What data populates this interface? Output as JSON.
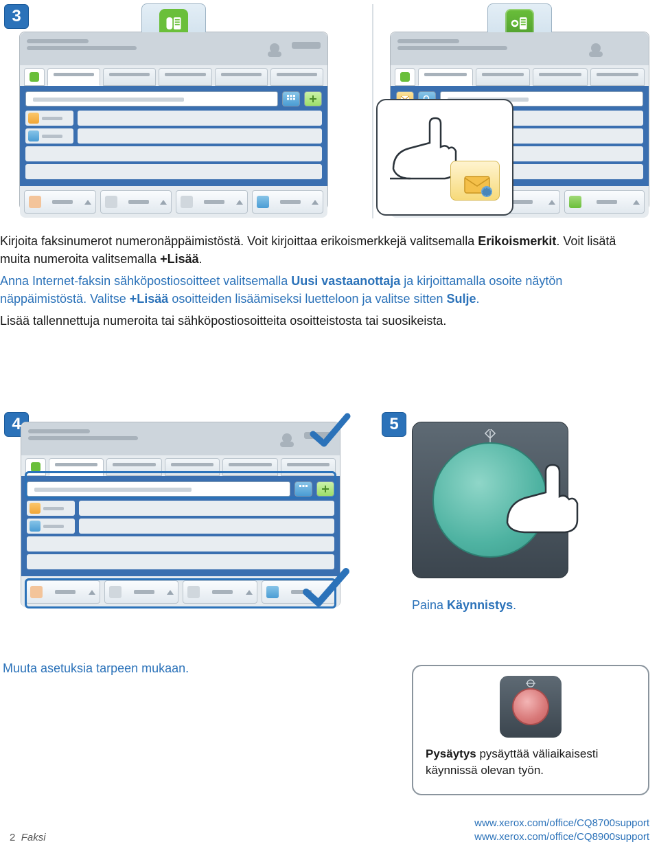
{
  "steps": {
    "s3": "3",
    "s4": "4",
    "s5": "5"
  },
  "instruction_block": {
    "line1a": "Kirjoita faksinumerot numeronäppäimistöstä. Voit kirjoittaa erikoismerkkejä valitsemalla ",
    "line1b_bold": "Erikoismerkit",
    "line1c": ". Voit lisätä muita numeroita valitsemalla ",
    "line1d_bold": "+Lisää",
    "line1e": ".",
    "line2a": "Anna Internet-faksin sähköpostiosoitteet valitsemalla ",
    "line2b_bold": "Uusi vastaanottaja",
    "line2c": " ja kirjoittamalla osoite näytön näppäimistöstä. Valitse ",
    "line2d_bold": "+Lisää",
    "line2e": " osoitteiden lisäämiseksi luetteloon ja valitse sitten ",
    "line2f_bold": "Sulje",
    "line2g": ".",
    "line3": "Lisää tallennettuja numeroita tai sähköpostiosoitteita osoitteistosta tai suosikeista."
  },
  "step5_caption_a": "Paina ",
  "step5_caption_b_bold": "Käynnistys",
  "step5_caption_c": ".",
  "step4_caption": "Muuta asetuksia tarpeen mukaan.",
  "stop_a_bold": "Pysäytys",
  "stop_b": " pysäyttää väliaikaisesti käynnissä olevan työn.",
  "footer": {
    "page_num": "2",
    "page_title": "Faksi",
    "url1": "www.xerox.com/office/CQ8700support",
    "url2": "www.xerox.com/office/CQ8900support"
  }
}
